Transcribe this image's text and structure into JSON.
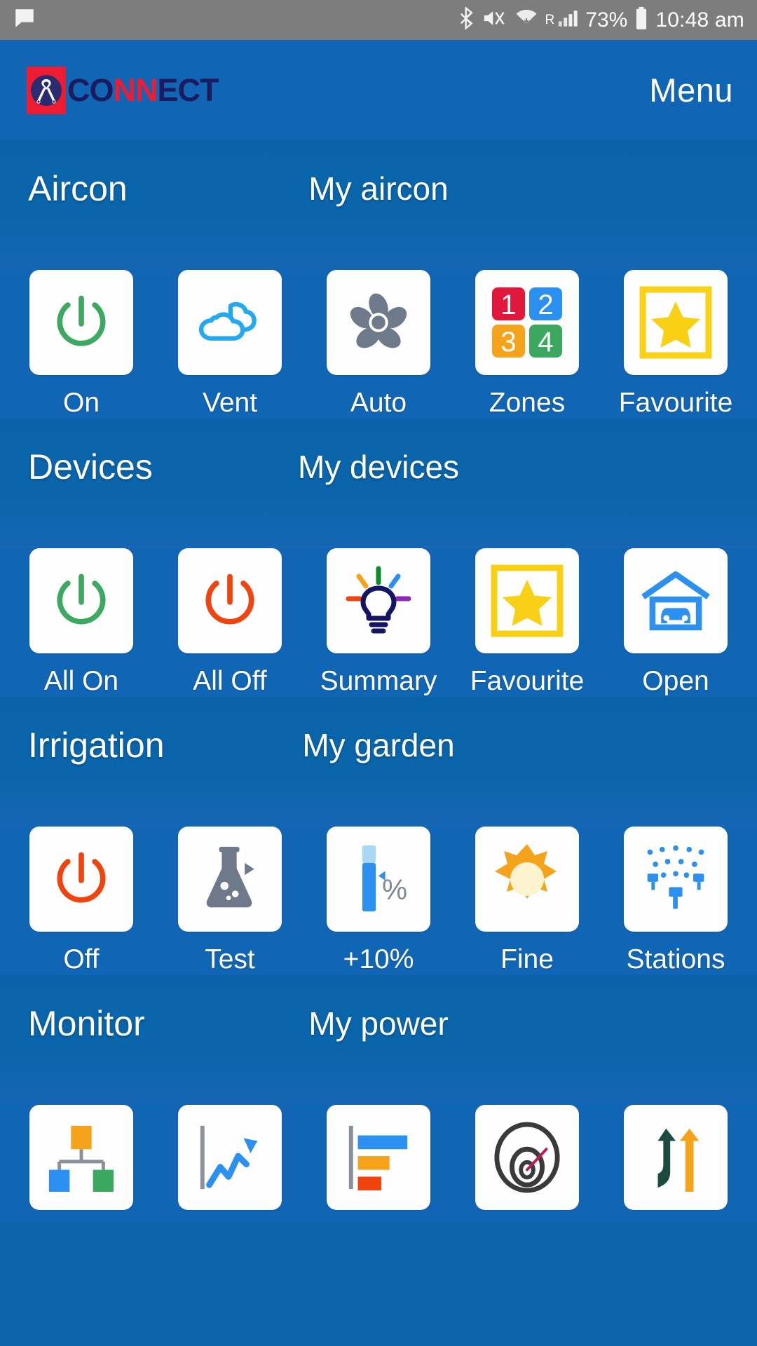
{
  "statusbar": {
    "message_icon": "chat-bubble-icon",
    "bluetooth_icon": "bluetooth-icon",
    "mute_icon": "volume-mute-vibrate-icon",
    "wifi_icon": "wifi-icon",
    "roaming_label": "R",
    "signal_icon": "cellular-signal-icon",
    "battery_percent": "73%",
    "battery_icon": "battery-icon",
    "time": "10:48 am"
  },
  "header": {
    "logo_badge_icon": "connect-ribbon-logo",
    "logo_text_part1": "CO",
    "logo_text_part2": "NN",
    "logo_text_part3": "ECT",
    "menu_label": "Menu",
    "accent_red": "#ee1c32",
    "accent_navy": "#1b1b5e",
    "bar_blue": "#1165b5"
  },
  "sections": [
    {
      "id": "aircon",
      "left_title": "Aircon",
      "right_title": "My aircon",
      "tiles": [
        {
          "label": "On",
          "icon": "power-on-icon"
        },
        {
          "label": "Vent",
          "icon": "cloud-vent-icon"
        },
        {
          "label": "Auto",
          "icon": "fan-auto-icon"
        },
        {
          "label": "Zones",
          "icon": "zones-1234-icon"
        },
        {
          "label": "Favourite",
          "icon": "favourite-star-icon"
        }
      ]
    },
    {
      "id": "devices",
      "left_title": "Devices",
      "right_title": "My devices",
      "tiles": [
        {
          "label": "All On",
          "icon": "power-on-icon"
        },
        {
          "label": "All Off",
          "icon": "power-off-icon"
        },
        {
          "label": "Summary",
          "icon": "lightbulb-summary-icon"
        },
        {
          "label": "Favourite",
          "icon": "favourite-star-icon"
        },
        {
          "label": "Open",
          "icon": "garage-open-icon"
        }
      ]
    },
    {
      "id": "irrigation",
      "left_title": "Irrigation",
      "right_title": "My garden",
      "tiles": [
        {
          "label": "Off",
          "icon": "power-off-icon"
        },
        {
          "label": "Test",
          "icon": "flask-test-icon"
        },
        {
          "label": "+10%",
          "icon": "percent-slider-icon"
        },
        {
          "label": "Fine",
          "icon": "sun-fine-icon"
        },
        {
          "label": "Stations",
          "icon": "sprinkler-stations-icon"
        }
      ]
    },
    {
      "id": "monitor",
      "left_title": "Monitor",
      "right_title": "My power",
      "tiles": [
        {
          "label": "",
          "icon": "hierarchy-tree-icon"
        },
        {
          "label": "",
          "icon": "trend-line-chart-icon"
        },
        {
          "label": "",
          "icon": "bar-chart-icon"
        },
        {
          "label": "",
          "icon": "gauge-meter-icon"
        },
        {
          "label": "",
          "icon": "import-export-arrows-icon"
        }
      ]
    }
  ],
  "colors": {
    "zone1_red": "#e0193c",
    "zone2_blue": "#2b90ef",
    "zone3_orange": "#f5a31b",
    "zone4_green": "#3ba860",
    "star_yellow": "#f8d117",
    "green_power": "#3da85f",
    "red_power": "#f0430e",
    "cyan_cloud": "#23a9f2",
    "fan_grey": "#6e7a8a",
    "page_blue": "#0a63a9"
  }
}
